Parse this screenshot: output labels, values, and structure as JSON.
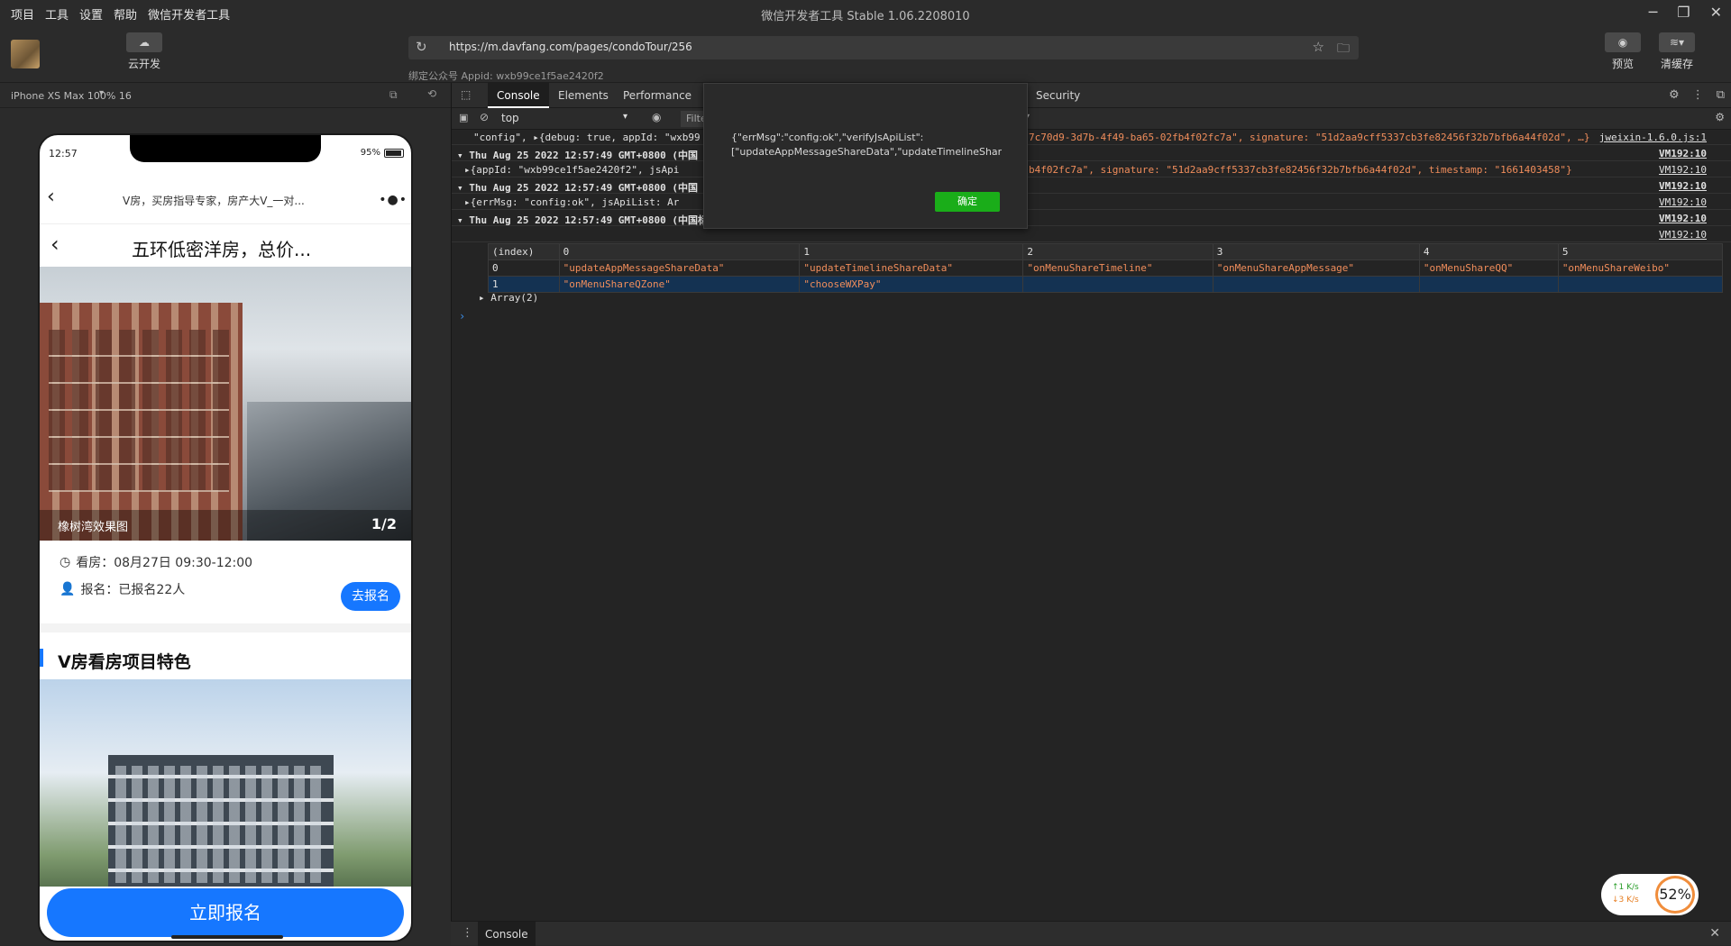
{
  "menu": [
    "项目",
    "工具",
    "设置",
    "帮助",
    "微信开发者工具"
  ],
  "app_title": "微信开发者工具 Stable 1.06.2208010",
  "toolbar": {
    "cloud_label": "云开发",
    "preview_label": "预览",
    "clear_cache_label": "清缓存",
    "url": "https://m.davfang.com/pages/condoTour/256",
    "appid": "绑定公众号 Appid: wxb99ce1f5ae2420f2"
  },
  "simulator": {
    "device": "iPhone XS Max 100% 16",
    "status_time": "12:57",
    "battery": "95%",
    "wx_title": "V房，买房指导专家，房产大V_一对...",
    "page_title": "五环低密洋房，总价...",
    "photo_caption": "橡树湾效果图",
    "photo_counter": "1/2",
    "visit_time": "看房：08月27日 09:30-12:00",
    "signed_count": "报名：已报名22人",
    "signup_small": "去报名",
    "section_title": "V房看房项目特色",
    "signup_big": "立即报名"
  },
  "devtools": {
    "tabs": [
      "Console",
      "Elements",
      "Performance",
      "Security"
    ],
    "context": "top",
    "filter_placeholder": "Filter",
    "lines": [
      {
        "text": "\"config\",  ▸{debug: true, appId: \"wxb99",
        "tail": "7c70d9-3d7b-4f49-ba65-02fb4f02fc7a\", signature: \"51d2aa9cff5337cb3fe82456f32b7bfb6a44f02d\", …}",
        "src": "jweixin-1.6.0.js:1"
      },
      {
        "text": "▾ Thu Aug 25 2022 12:57:49 GMT+0800 (中国",
        "tail": "",
        "src": "VM192:10"
      },
      {
        "text": "  ▸{appId: \"wxb99ce1f5ae2420f2\", jsApi",
        "tail": "b4f02fc7a\", signature: \"51d2aa9cff5337cb3fe82456f32b7bfb6a44f02d\", timestamp: \"1661403458\"}",
        "src": "VM192:10"
      },
      {
        "text": "▾ Thu Aug 25 2022 12:57:49 GMT+0800 (中国",
        "tail": "",
        "src": "VM192:10"
      },
      {
        "text": "  ▸{errMsg: \"config:ok\", jsApiList: Ar",
        "tail": "",
        "src": "VM192:10"
      },
      {
        "text": "▾ Thu Aug 25 2022 12:57:49 GMT+0800 (中国标准时间) 当前页面通过 wx.config 获取到的 JSSDK 权限如下",
        "tail": "",
        "src": "VM192:10"
      },
      {
        "text": "",
        "tail": "",
        "src": "VM192:10"
      }
    ],
    "table": {
      "headers": [
        "(index)",
        "0",
        "1",
        "2",
        "3",
        "4",
        "5"
      ],
      "rows": [
        [
          "0",
          "\"updateAppMessageShareData\"",
          "\"updateTimelineShareData\"",
          "\"onMenuShareTimeline\"",
          "\"onMenuShareAppMessage\"",
          "\"onMenuShareQQ\"",
          "\"onMenuShareWeibo\""
        ],
        [
          "1",
          "\"onMenuShareQZone\"",
          "\"chooseWXPay\"",
          "",
          "",
          "",
          ""
        ]
      ]
    },
    "array_line": "▸ Array(2)",
    "drawer_tab": "Console"
  },
  "popup": {
    "message": "{\"errMsg\":\"config:ok\",\"verifyJsApiList\":\n[\"updateAppMessageShareData\",\"updateTimelineShareD",
    "ok_label": "确定"
  },
  "netwidget": {
    "up": "↑1  K/s",
    "down": "↓3  K/s",
    "percent": "52%"
  }
}
